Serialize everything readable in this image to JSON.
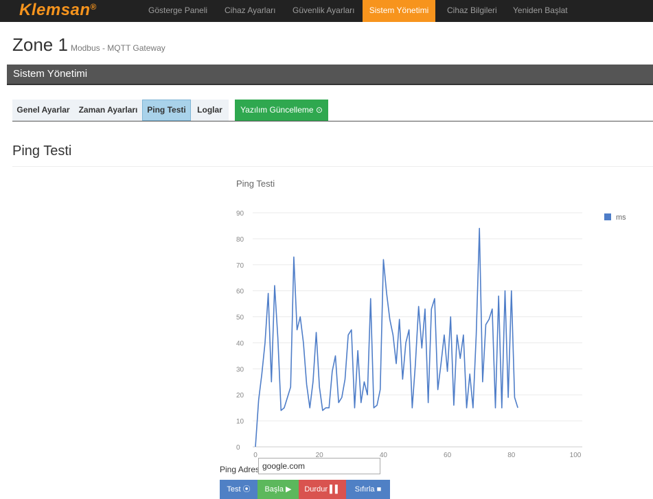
{
  "brand": {
    "name": "Klemsan",
    "mark": "®"
  },
  "nav": [
    {
      "label": "Gösterge Paneli",
      "active": false
    },
    {
      "label": "Cihaz Ayarları",
      "active": false
    },
    {
      "label": "Güvenlik Ayarları",
      "active": false
    },
    {
      "label": "Sistem Yönetimi",
      "active": true
    },
    {
      "label": "Cihaz Bilgileri",
      "active": false
    },
    {
      "label": "Yeniden Başlat",
      "active": false
    }
  ],
  "header": {
    "title": "Zone 1",
    "subtitle": "Modbus - MQTT Gateway"
  },
  "section": {
    "title": "Sistem Yönetimi"
  },
  "tabs": [
    {
      "label": "Genel Ayarlar"
    },
    {
      "label": "Zaman Ayarları"
    },
    {
      "label": "Ping Testi",
      "active": true
    },
    {
      "label": "Loglar"
    },
    {
      "label": "Yazılım Güncelleme ⊙"
    }
  ],
  "page": {
    "title": "Ping Testi"
  },
  "chart_data": {
    "type": "line",
    "title": "Ping Testi",
    "xlim": [
      0,
      100
    ],
    "ylim": [
      0,
      90
    ],
    "x_ticks": [
      0,
      20,
      40,
      60,
      80,
      100
    ],
    "y_ticks": [
      0,
      10,
      20,
      30,
      40,
      50,
      60,
      70,
      80,
      90
    ],
    "grid": true,
    "legend": "right",
    "series": [
      {
        "name": "ms",
        "color": "#4e7dc8",
        "values": [
          0,
          18,
          28,
          40,
          59,
          25,
          62,
          42,
          14,
          15,
          19,
          23,
          73,
          45,
          50,
          40,
          24,
          15,
          25,
          44,
          23,
          14,
          15,
          15,
          29,
          35,
          17,
          19,
          26,
          43,
          45,
          15,
          37,
          17,
          25,
          20,
          57,
          15,
          16,
          22,
          72,
          59,
          49,
          43,
          32,
          49,
          26,
          40,
          45,
          15,
          32,
          54,
          38,
          53,
          17,
          53,
          57,
          22,
          32,
          43,
          29,
          50,
          16,
          43,
          34,
          43,
          15,
          28,
          15,
          43,
          84,
          25,
          47,
          49,
          53,
          15,
          58,
          15,
          60,
          19,
          60,
          19,
          15
        ]
      }
    ]
  },
  "ping": {
    "label": "Ping Adresi",
    "value": "google.com"
  },
  "buttons": {
    "test": "Test ⦿",
    "start": "Başla ▶",
    "stop": "Durdur ▌▌",
    "reset": "Sıfırla ■"
  }
}
